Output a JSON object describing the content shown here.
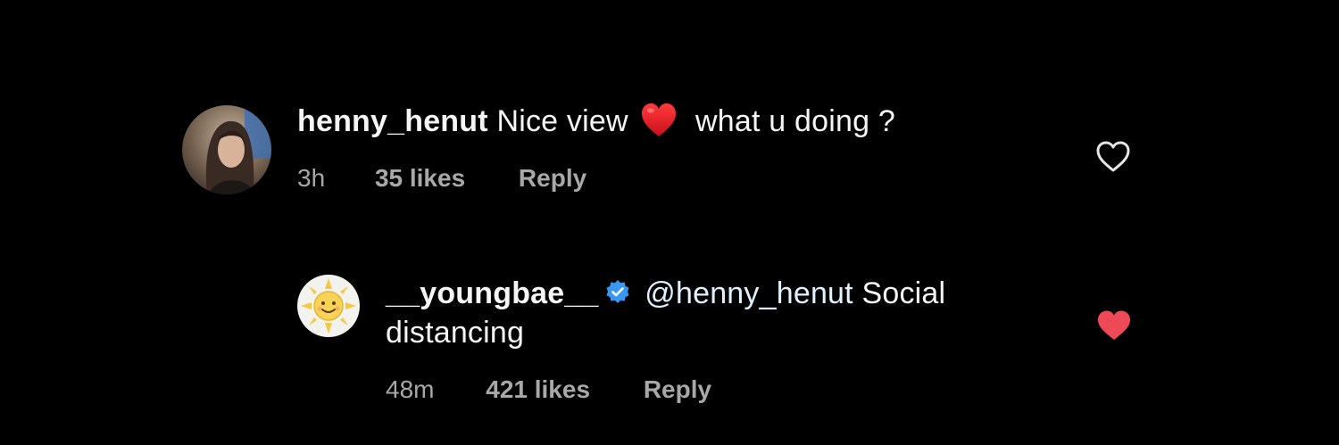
{
  "comments": [
    {
      "username": "henny_henut",
      "text_before_emoji": "Nice view",
      "emoji": "red-heart-emoji",
      "text_after_emoji": "what u doing ?",
      "time": "3h",
      "likes": "35 likes",
      "reply_label": "Reply",
      "liked": false
    },
    {
      "username": "__youngbae__",
      "verified": true,
      "mention": "@henny_henut",
      "text": "Social distancing",
      "time": "48m",
      "likes": "421 likes",
      "reply_label": "Reply",
      "liked": true
    }
  ],
  "colors": {
    "background": "#000000",
    "text": "#f5f5f5",
    "meta": "#a8a8a8",
    "like_active": "#ed4956",
    "verified": "#3897f0"
  }
}
